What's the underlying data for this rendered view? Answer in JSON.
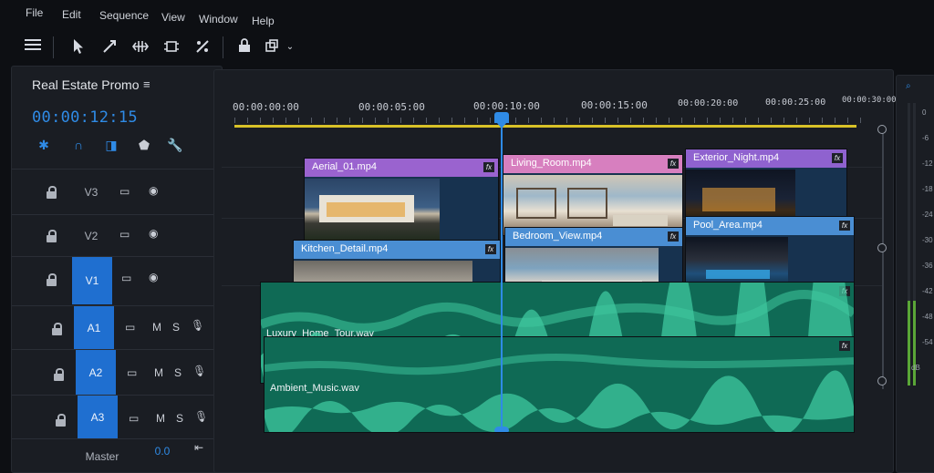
{
  "menu": [
    "File",
    "Edit",
    "Sequence",
    "View",
    "Window",
    "Help"
  ],
  "tools": [
    "hamburger-menu-icon",
    "selection-tool-icon",
    "track-select-icon",
    "ripple-edit-icon",
    "slip-tool-icon",
    "razor-tool-icon",
    "lock-icon",
    "multi-icon"
  ],
  "sequence": {
    "title": "Real Estate Promo",
    "timecode": "00:00:12:15"
  },
  "header_icons": [
    "snap-icon",
    "linked-selection-icon",
    "add-marker-icon",
    "marker-icon",
    "settings-wrench-icon"
  ],
  "tracks": {
    "video": [
      {
        "name": "V3",
        "targeted": false
      },
      {
        "name": "V2",
        "targeted": false
      },
      {
        "name": "V1",
        "targeted": true
      }
    ],
    "audio": [
      {
        "name": "A1",
        "m": "M",
        "s": "S"
      },
      {
        "name": "A2",
        "m": "M",
        "s": "S"
      },
      {
        "name": "A3",
        "m": "M",
        "s": "S"
      }
    ],
    "master": {
      "label": "Master",
      "value": "0.0"
    }
  },
  "ruler": [
    "00:00:00:00",
    "00:00:05:00",
    "00:00:10:00",
    "00:00:15:00",
    "00:00:20:00",
    "00:00:25:00",
    "00:00:30:00"
  ],
  "clips": {
    "v2": [
      {
        "name": "Aerial_01.mp4",
        "color": "#9a63cf",
        "fx": "fx"
      },
      {
        "name": "Living_Room.mp4",
        "color": "#d77fbf",
        "fx": "fx"
      },
      {
        "name": "Exterior_Night.mp4",
        "color": "#8f62cf",
        "fx": "fx"
      }
    ],
    "v1": [
      {
        "name": "Kitchen_Detail.mp4",
        "color": "#4a8ed3",
        "fx": "fx"
      },
      {
        "name": "Bedroom_View.mp4",
        "color": "#4a8ed3",
        "fx": "fx"
      },
      {
        "name": "Pool_Area.mp4",
        "color": "#4a8ed3",
        "fx": "fx"
      }
    ],
    "audio": [
      {
        "name": "Luxury_Home_Tour.wav",
        "color": "#0f6a55",
        "fx": "fx"
      },
      {
        "name": "Ambient_Music.wav",
        "color": "#0f6a55",
        "fx": "fx"
      }
    ]
  },
  "meter": {
    "labels": [
      "0",
      "-6",
      "-12",
      "-18",
      "-24",
      "-30",
      "-36",
      "-42",
      "-48",
      "-54",
      "dB"
    ],
    "level_db": -42
  },
  "colors": {
    "accent": "#2f8be6",
    "work_area": "#d8c228",
    "audio_clip": "#0f6a55"
  }
}
